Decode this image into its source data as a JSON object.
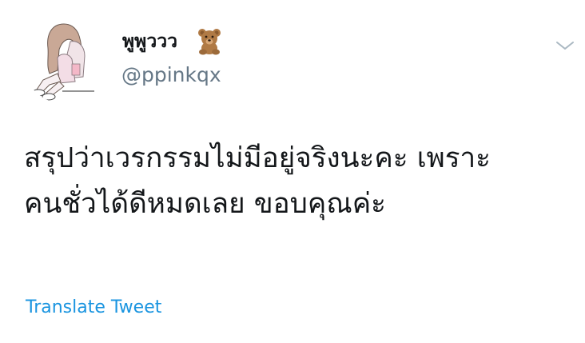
{
  "tweet": {
    "author": {
      "display_name": "พูพูววว",
      "emoji": "🧸",
      "handle": "@ppinkqx"
    },
    "text": "สรุปว่าเวรกรรมไม่มีอยู่จริงนะคะ เพราะ\nคนชั่วได้ดีหมดเลย ขอบคุณค่ะ",
    "translate_label": "Translate Tweet"
  },
  "icons": {
    "menu": "chevron-down-icon",
    "emoji": "teddy-bear-icon",
    "avatar": "avatar"
  },
  "colors": {
    "text": "#14171a",
    "secondary": "#657786",
    "link": "#1b95e0",
    "chevron": "#aab8c2"
  }
}
